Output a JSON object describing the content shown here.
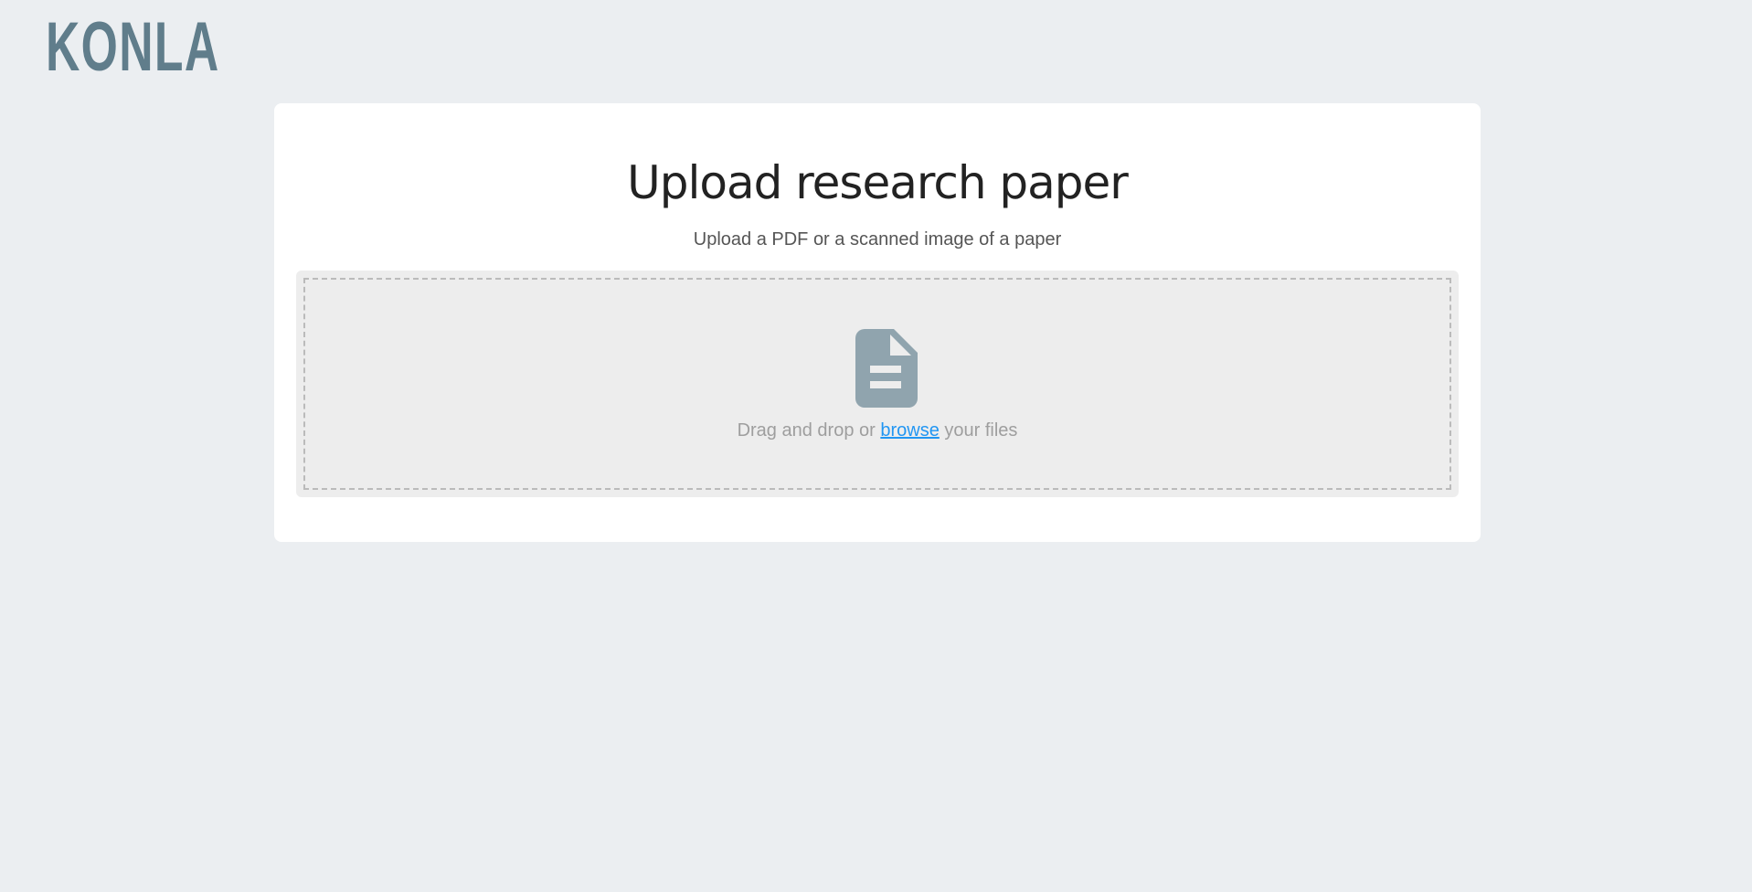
{
  "header": {
    "logo": "KONLA"
  },
  "upload": {
    "title": "Upload research paper",
    "subtitle": "Upload a PDF or a scanned image of a paper",
    "dropzone": {
      "text_before": "Drag and drop or ",
      "link": "browse",
      "text_after": " your files",
      "icon": "file-document-icon"
    }
  },
  "colors": {
    "brand": "#607d8b",
    "link": "#2196f3",
    "icon": "#90a4ae"
  }
}
